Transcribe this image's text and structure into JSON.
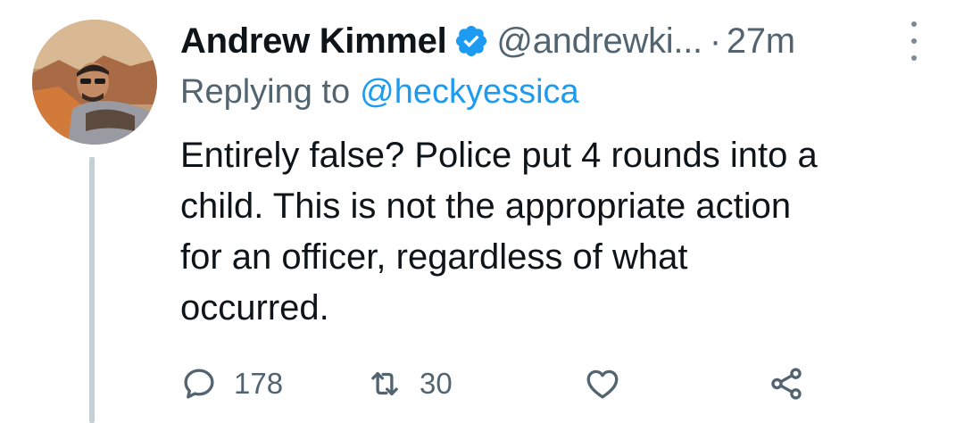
{
  "tweet": {
    "author_name": "Andrew Kimmel",
    "handle": "@andrewki...",
    "separator": "·",
    "time": "27m",
    "replying_label": "Replying to",
    "replying_handle": "@heckyessica",
    "body_lines": [
      "Entirely false? Police put 4 rounds into a",
      "child. This is not the appropriate action",
      "for an officer, regardless of what",
      "occurred."
    ],
    "reply_count": "178",
    "retweet_count": "30"
  },
  "icons": {
    "verified": "verified-badge-icon",
    "more": "more-vertical-icon",
    "reply": "reply-icon",
    "retweet": "retweet-icon",
    "like": "heart-icon",
    "share": "share-icon"
  },
  "colors": {
    "text": "#0f1419",
    "secondary": "#536471",
    "accent": "#1d9bf0",
    "thread_line": "#c4cfd6"
  }
}
